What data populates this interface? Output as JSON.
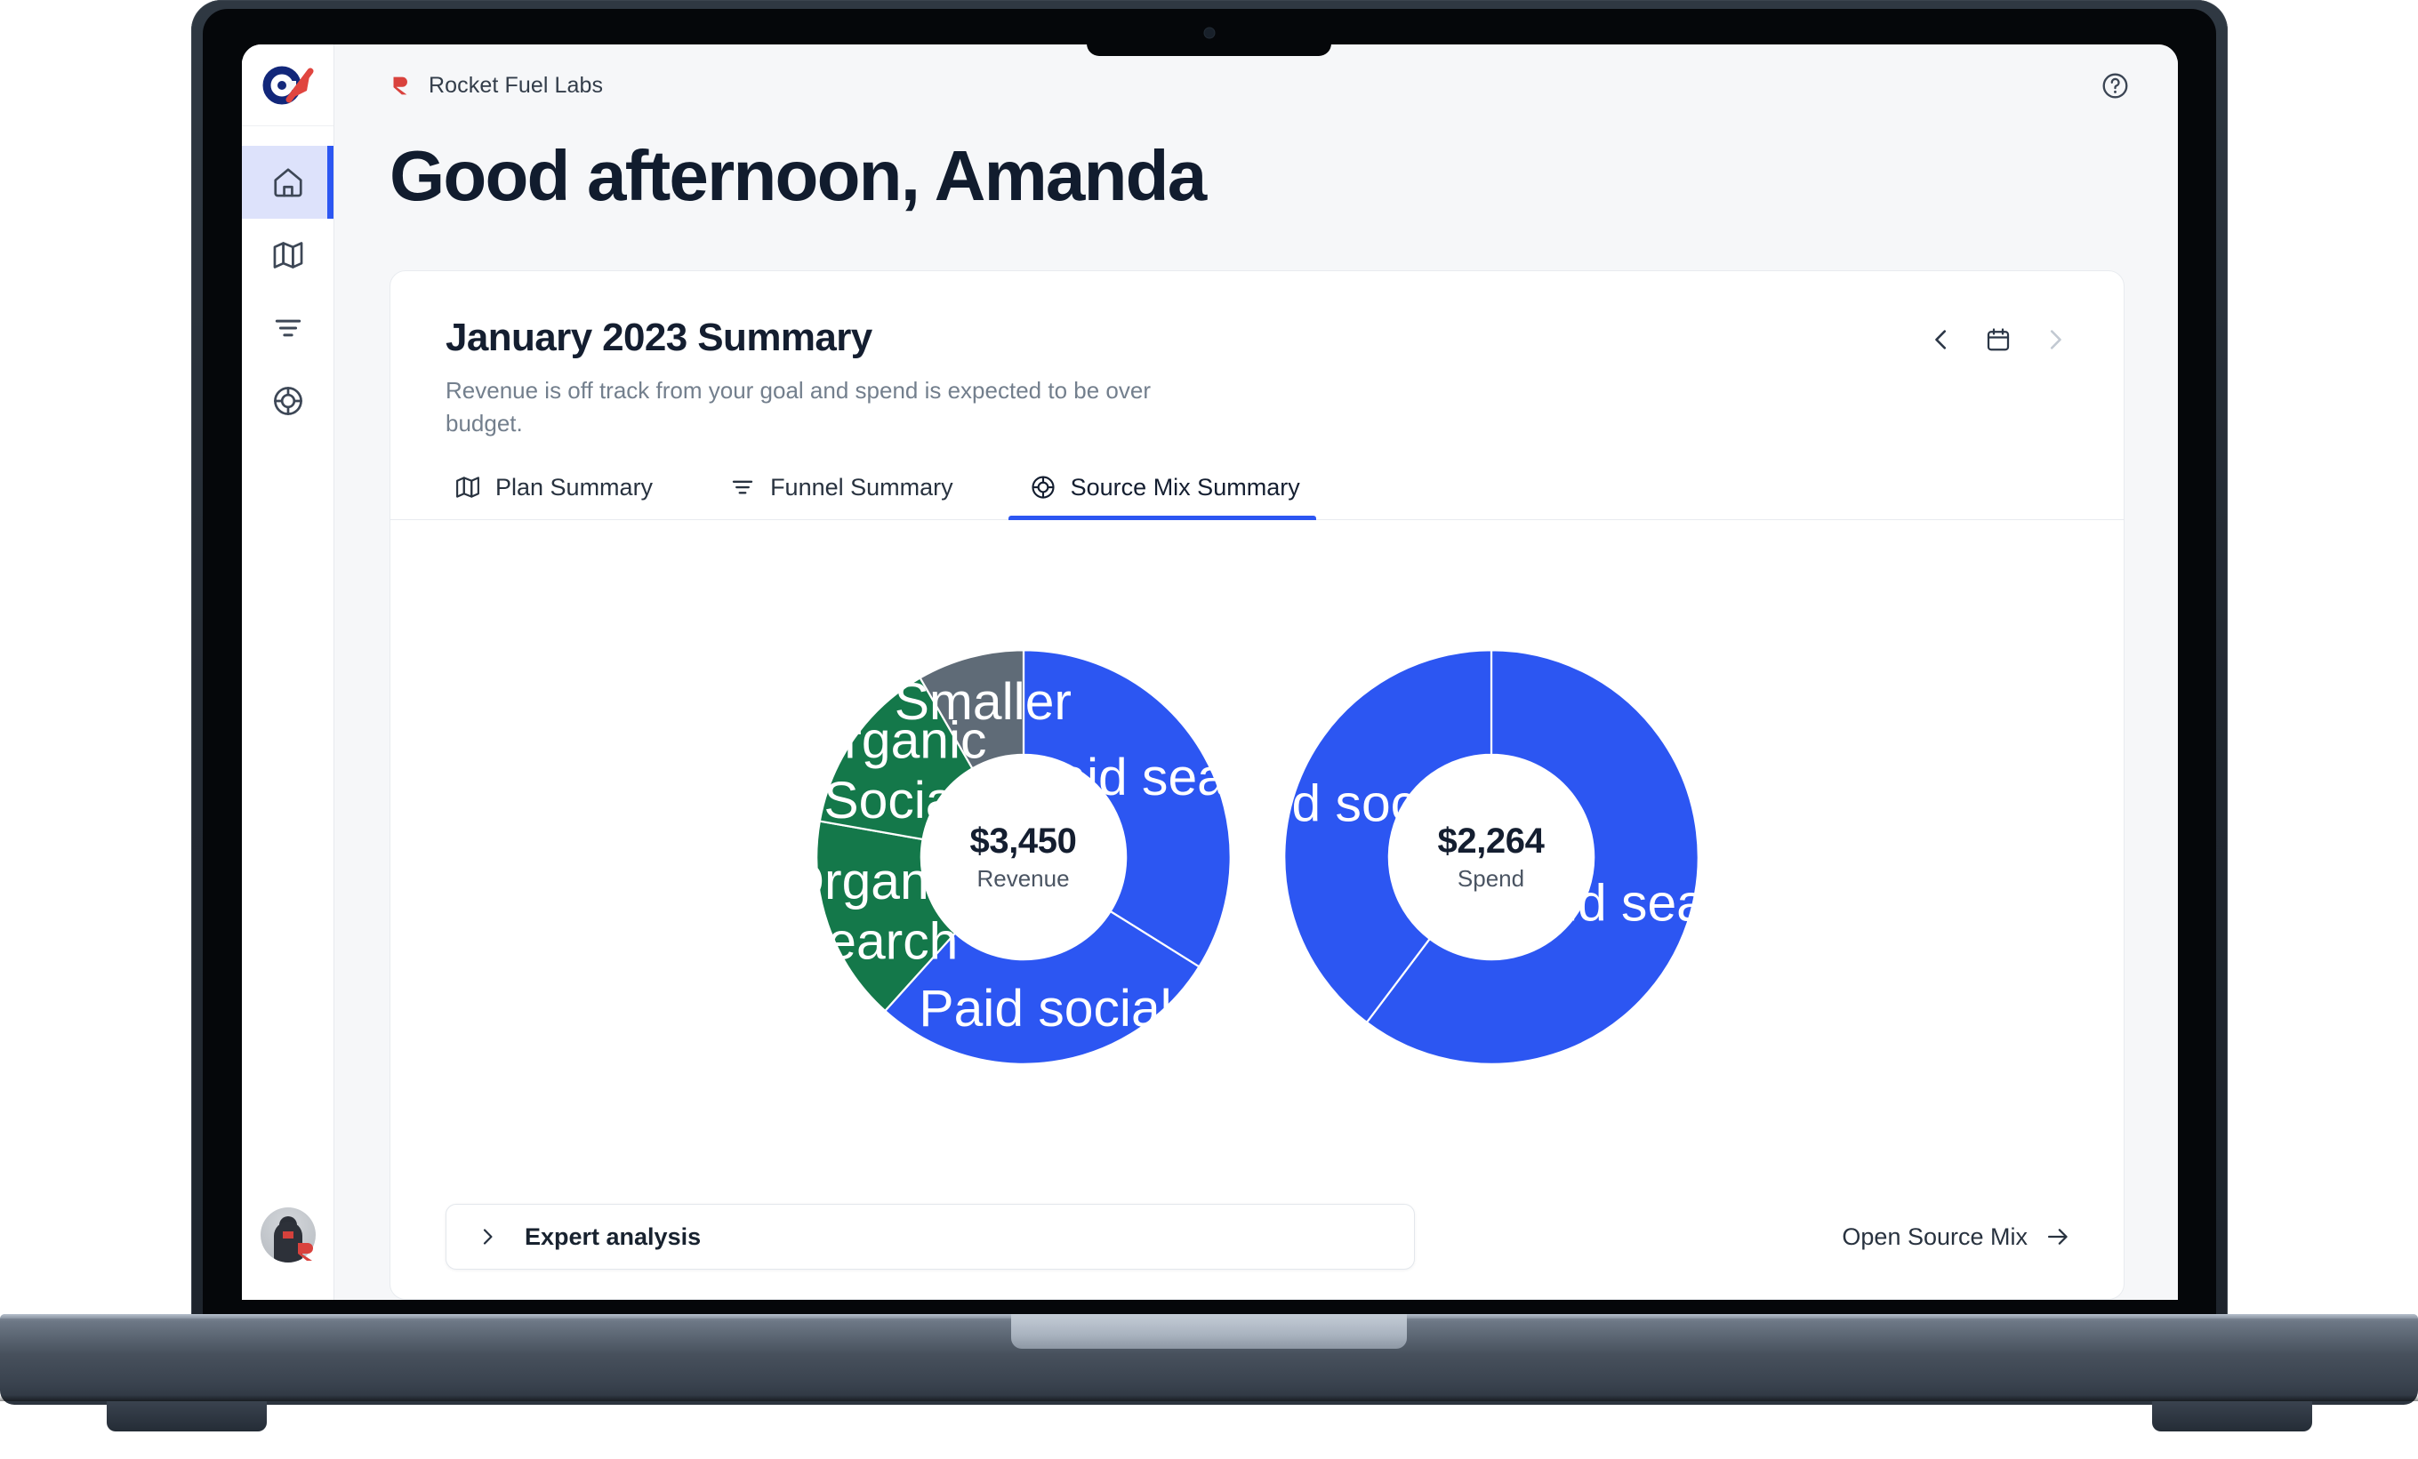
{
  "brand": {
    "logo_icon": "cx-logo-icon"
  },
  "sidebar": {
    "items": [
      {
        "icon": "home-icon",
        "name": "home",
        "active": true
      },
      {
        "icon": "map-icon",
        "name": "plan",
        "active": false
      },
      {
        "icon": "funnel-icon",
        "name": "funnel",
        "active": false
      },
      {
        "icon": "target-icon",
        "name": "source-mix",
        "active": false
      }
    ],
    "avatar": {
      "name": "user-avatar",
      "badge_icon": "rocket-fuel-badge-icon"
    }
  },
  "topbar": {
    "org_logo_icon": "rocket-fuel-logo-icon",
    "org_name": "Rocket Fuel Labs",
    "help_icon": "help-circle-icon"
  },
  "greeting": "Good afternoon, Amanda",
  "card": {
    "title": "January 2023 Summary",
    "subtitle": "Revenue is off track from your goal and spend is expected to be over budget.",
    "date_nav": {
      "prev_icon": "chevron-left-icon",
      "calendar_icon": "calendar-icon",
      "next_icon": "chevron-right-icon",
      "next_disabled": true
    },
    "tabs": [
      {
        "label": "Plan Summary",
        "icon": "map-icon",
        "active": false
      },
      {
        "label": "Funnel Summary",
        "icon": "funnel-icon",
        "active": false
      },
      {
        "label": "Source Mix Summary",
        "icon": "target-icon",
        "active": true
      }
    ],
    "footer": {
      "expert_label": "Expert analysis",
      "expert_icon": "chevron-right-icon",
      "open_label": "Open Source Mix",
      "open_icon": "arrow-right-icon"
    }
  },
  "colors": {
    "blue": "#2c56f2",
    "green": "#14784a",
    "gray": "#5f6b77",
    "accent": "#2c56f2",
    "text_dark": "#141e30",
    "text_muted": "#737f8d",
    "page_bg": "#f6f7f9"
  },
  "chart_data": [
    {
      "type": "pie",
      "title": "Revenue",
      "center_value": "$3,450",
      "center_label": "Revenue",
      "donut": true,
      "start_angle": 0,
      "labels": [
        "Paid search",
        "Paid social",
        "Organic Search",
        "Organic Social",
        "Smaller"
      ],
      "values": [
        34,
        28,
        16,
        14,
        8
      ],
      "colors": [
        "#2c56f2",
        "#2c56f2",
        "#14784a",
        "#14784a",
        "#5f6b77"
      ],
      "slices": [
        {
          "label": "Paid search",
          "value": 34,
          "color": "#2c56f2",
          "start": 0,
          "end": 122
        },
        {
          "label": "Paid social",
          "value": 28,
          "color": "#2c56f2",
          "start": 122,
          "end": 222
        },
        {
          "label": "Organic Search",
          "value": 16,
          "color": "#14784a",
          "start": 222,
          "end": 280
        },
        {
          "label": "Organic Social",
          "value": 14,
          "color": "#14784a",
          "start": 280,
          "end": 330
        },
        {
          "label": "Smaller",
          "value": 8,
          "color": "#5f6b77",
          "start": 330,
          "end": 360
        }
      ]
    },
    {
      "type": "pie",
      "title": "Spend",
      "center_value": "$2,264",
      "center_label": "Spend",
      "donut": true,
      "start_angle": 0,
      "labels": [
        "Paid search",
        "Paid social"
      ],
      "values": [
        60,
        40
      ],
      "colors": [
        "#2c56f2",
        "#2c56f2"
      ],
      "slices": [
        {
          "label": "Paid search",
          "value": 60,
          "color": "#2c56f2",
          "start": 0,
          "end": 217
        },
        {
          "label": "Paid social",
          "value": 40,
          "color": "#2c56f2",
          "start": 217,
          "end": 360
        }
      ]
    }
  ]
}
